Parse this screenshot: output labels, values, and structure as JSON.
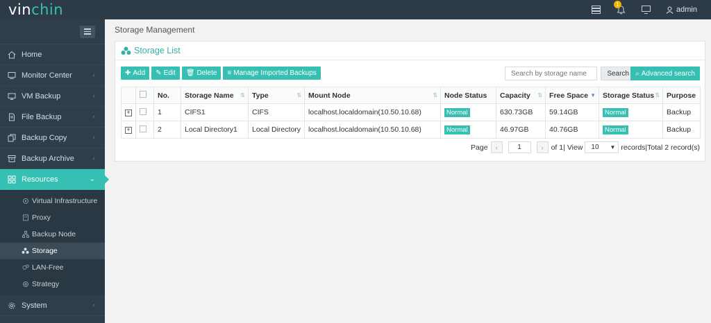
{
  "app": {
    "logo_prefix": "vin",
    "logo_accent": "chin",
    "notification_count": "1",
    "user": "admin",
    "accent_color": "#35c0b3"
  },
  "sidebar": {
    "items": [
      {
        "label": "Home",
        "icon": "home-icon"
      },
      {
        "label": "Monitor Center",
        "icon": "monitor-icon"
      },
      {
        "label": "VM Backup",
        "icon": "vm-icon"
      },
      {
        "label": "File Backup",
        "icon": "file-icon"
      },
      {
        "label": "Backup Copy",
        "icon": "copy-icon"
      },
      {
        "label": "Backup Archive",
        "icon": "archive-icon"
      },
      {
        "label": "Resources",
        "icon": "resources-icon"
      },
      {
        "label": "System",
        "icon": "gear-icon"
      }
    ],
    "sub_items": [
      {
        "label": "Virtual Infrastructure"
      },
      {
        "label": "Proxy"
      },
      {
        "label": "Backup Node"
      },
      {
        "label": "Storage"
      },
      {
        "label": "LAN-Free"
      },
      {
        "label": "Strategy"
      }
    ]
  },
  "page": {
    "title": "Storage Management",
    "panel_title": "Storage List"
  },
  "toolbar": {
    "add": "Add",
    "edit": "Edit",
    "delete": "Delete",
    "manage": "Manage Imported Backups",
    "search_placeholder": "Search by storage name",
    "search": "Search",
    "advanced": "Advanced search"
  },
  "table": {
    "headers": [
      "No.",
      "Storage Name",
      "Type",
      "Mount Node",
      "Node Status",
      "Capacity",
      "Free Space",
      "Storage Status",
      "Purpose"
    ],
    "rows": [
      {
        "no": "1",
        "name": "CIFS1",
        "type": "CIFS",
        "mount": "localhost.localdomain(10.50.10.68)",
        "node_status": "Normal",
        "capacity": "630.73GB",
        "free": "59.14GB",
        "storage_status": "Normal",
        "purpose": "Backup"
      },
      {
        "no": "2",
        "name": "Local Directory1",
        "type": "Local Directory",
        "mount": "localhost.localdomain(10.50.10.68)",
        "node_status": "Normal",
        "capacity": "46.97GB",
        "free": "40.76GB",
        "storage_status": "Normal",
        "purpose": "Backup"
      }
    ]
  },
  "pager": {
    "page_label": "Page",
    "page_value": "1",
    "of_label": "of 1|",
    "view_label": "View",
    "view_value": "10",
    "records_label": "records|Total 2 record(s)"
  }
}
